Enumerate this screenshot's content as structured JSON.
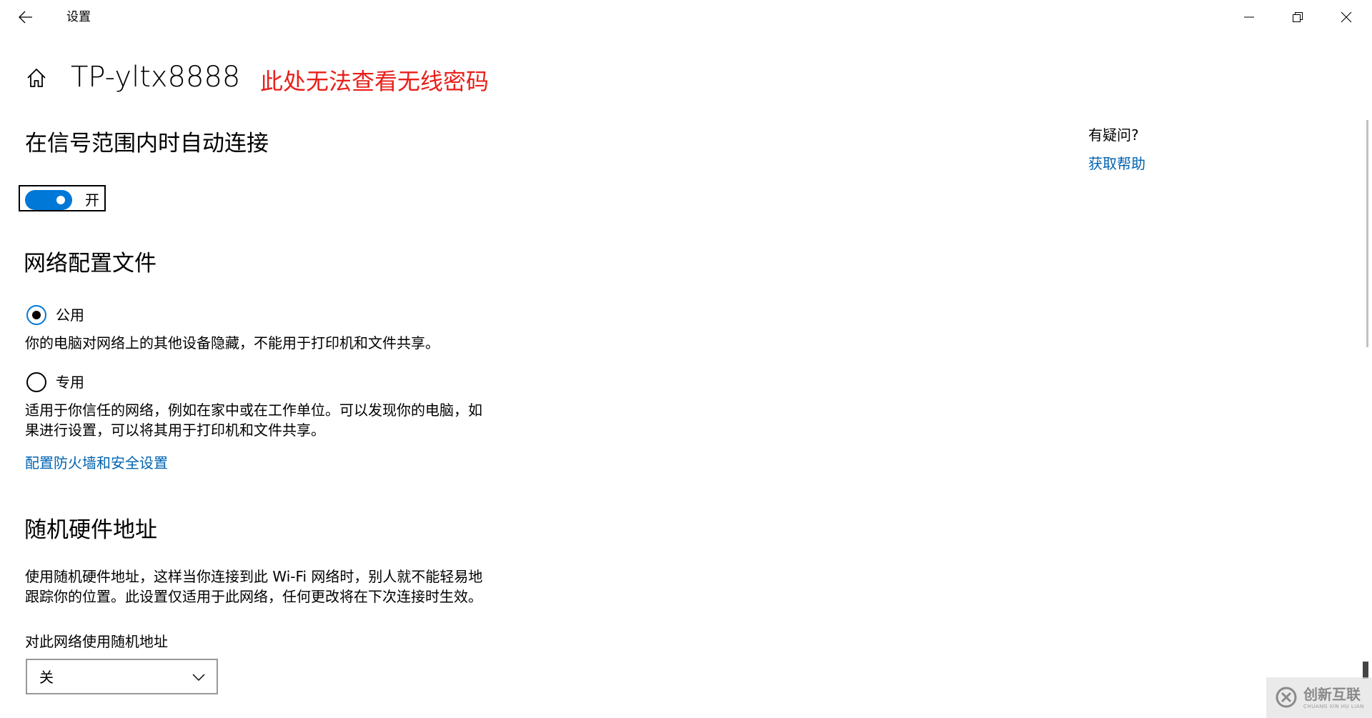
{
  "window": {
    "title": "设置",
    "icons": {
      "back": "back-arrow-icon",
      "minimize": "minimize-icon",
      "maximize": "restore-icon",
      "close": "close-icon"
    }
  },
  "header": {
    "home_icon": "home-icon",
    "network_name": "TP-yltx8888",
    "annotation": "此处无法查看无线密码",
    "annotation_color": "#e8201a"
  },
  "auto_connect": {
    "heading": "在信号范围内时自动连接",
    "toggle_state": "开",
    "toggle_on": true,
    "accent_color": "#0078d7"
  },
  "network_profile": {
    "heading": "网络配置文件",
    "options": [
      {
        "label": "公用",
        "selected": true,
        "description": "你的电脑对网络上的其他设备隐藏，不能用于打印机和文件共享。"
      },
      {
        "label": "专用",
        "selected": false,
        "description_line1": "适用于你信任的网络，例如在家中或在工作单位。可以发现你的电脑，如",
        "description_line2": "果进行设置，可以将其用于打印机和文件共享。"
      }
    ],
    "firewall_link": "配置防火墙和安全设置",
    "link_color": "#0063b1"
  },
  "random_hw": {
    "heading": "随机硬件地址",
    "description_line1": "使用随机硬件地址，这样当你连接到此 Wi-Fi 网络时，别人就不能轻易地",
    "description_line2": "跟踪你的位置。此设置仅适用于此网络，任何更改将在下次连接时生效。",
    "dropdown_label": "对此网络使用随机地址",
    "dropdown_value": "关",
    "dropdown_icon": "chevron-down-icon"
  },
  "help": {
    "question": "有疑问?",
    "link": "获取帮助"
  },
  "watermark": {
    "text": "创新互联",
    "subtext": "CHUANG XIN HU LIAN"
  }
}
